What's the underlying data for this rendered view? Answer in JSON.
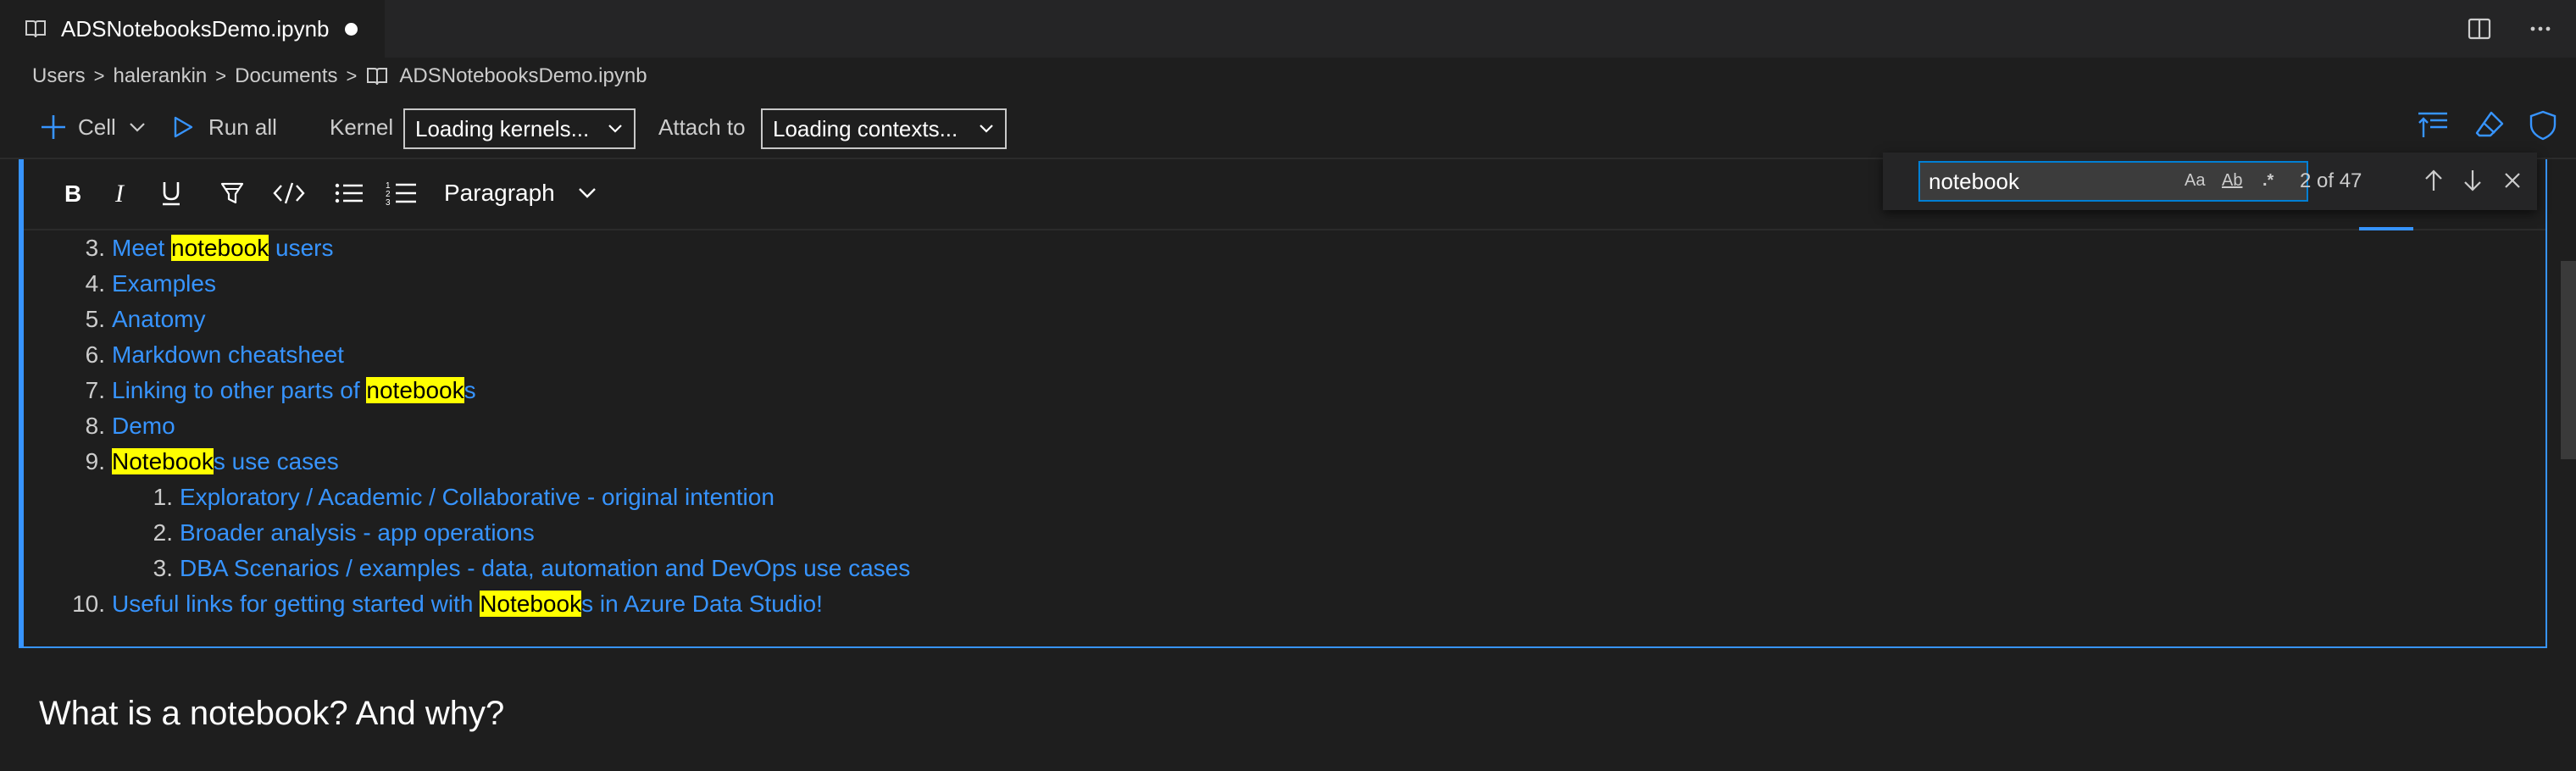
{
  "tab": {
    "title": "ADSNotebooksDemo.ipynb",
    "book_icon": "book-icon",
    "dirty_indicator": "unsaved-dot"
  },
  "tab_actions": {
    "split_icon": "split-editor-icon",
    "more_icon": "more-icon"
  },
  "breadcrumb": {
    "items": [
      "Users",
      "halerankin",
      "Documents",
      "ADSNotebooksDemo.ipynb"
    ],
    "separator": ">"
  },
  "toolbar": {
    "cell_label": "Cell",
    "run_all_label": "Run all",
    "kernel_label": "Kernel",
    "kernel_value": "Loading kernels...",
    "attach_label": "Attach to",
    "attach_value": "Loading contexts...",
    "right_icons": [
      "collapse-cells-icon",
      "clear-results-icon",
      "trusted-shield-icon"
    ]
  },
  "markdown_toolbar": {
    "buttons": [
      "bold-icon",
      "italic-icon",
      "underline-icon",
      "highlight-icon",
      "code-icon",
      "bullet-list-icon",
      "numbered-list-icon"
    ],
    "paragraph_label": "Paragraph"
  },
  "find": {
    "query": "notebook",
    "match_case_label": "Aa",
    "whole_word_label": "Ab",
    "regex_label": ".*",
    "count": "2 of 47",
    "icons": [
      "previous-match-icon",
      "next-match-icon",
      "close-icon"
    ]
  },
  "toc": {
    "items": [
      {
        "num": "3.",
        "parts": [
          {
            "t": "Meet "
          },
          {
            "t": "notebook",
            "hl": true
          },
          {
            "t": " users"
          }
        ]
      },
      {
        "num": "4.",
        "parts": [
          {
            "t": "Examples"
          }
        ]
      },
      {
        "num": "5.",
        "parts": [
          {
            "t": "Anatomy"
          }
        ]
      },
      {
        "num": "6.",
        "parts": [
          {
            "t": "Markdown cheatsheet"
          }
        ]
      },
      {
        "num": "7.",
        "parts": [
          {
            "t": "Linking to other parts of "
          },
          {
            "t": "notebook",
            "hl": true
          },
          {
            "t": "s"
          }
        ]
      },
      {
        "num": "8.",
        "parts": [
          {
            "t": "Demo"
          }
        ]
      },
      {
        "num": "9.",
        "parts": [
          {
            "t": "Notebook",
            "hl": true
          },
          {
            "t": "s use cases"
          }
        ]
      },
      {
        "num": "1.",
        "sub": true,
        "parts": [
          {
            "t": "Exploratory / Academic / Collaborative - original intention"
          }
        ]
      },
      {
        "num": "2.",
        "sub": true,
        "parts": [
          {
            "t": "Broader analysis - app operations"
          }
        ]
      },
      {
        "num": "3.",
        "sub": true,
        "parts": [
          {
            "t": "DBA Scenarios / examples - data, automation and DevOps use cases"
          }
        ]
      },
      {
        "num": "10.",
        "parts": [
          {
            "t": "Useful links for getting started with "
          },
          {
            "t": "Notebook",
            "hl": true
          },
          {
            "t": "s in Azure Data Studio!"
          }
        ]
      }
    ]
  },
  "next_heading": "What is a notebook? And why?",
  "colors": {
    "accent": "#3794ff",
    "highlight": "#ffff00",
    "background": "#1e1e1e"
  }
}
